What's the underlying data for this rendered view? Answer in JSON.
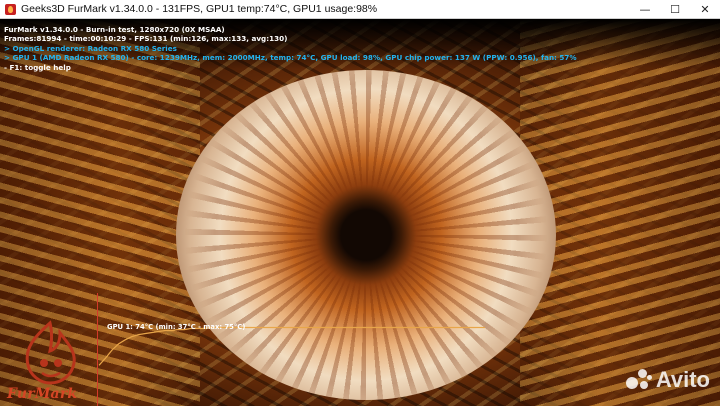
{
  "window": {
    "title": "Geeks3D FurMark v1.34.0.0 - 131FPS, GPU1 temp:74°C, GPU1 usage:98%",
    "icon": "furmark-app-icon",
    "controls": {
      "minimize": "—",
      "maximize": "☐",
      "close": "✕"
    }
  },
  "hud": {
    "line1": "FurMark v1.34.0.0 - Burn-in test, 1280x720 (0X MSAA)",
    "line2": "Frames:81994 - time:00:10:29 - FPS:131 (min:126, max:133, avg:130)",
    "line3": "> OpenGL renderer: Radeon RX 580 Series",
    "line4": "> GPU 1 (AMD Radeon RX 580) - core: 1239MHz, mem: 2000MHz, temp: 74°C, GPU load: 98%, GPU chip power: 137 W (PPW: 0.956), fan: 57%",
    "line5": "- F1: toggle help",
    "colors": {
      "white": "#ffffff",
      "cyan": "#23b3ee"
    }
  },
  "graph": {
    "label": "GPU 1: 74°C (min: 37°C - max: 75°C)",
    "axis_color": "#d33a2a",
    "line_color": "#e8a64a",
    "temps_c": [
      37,
      44,
      52,
      58,
      62,
      65,
      67,
      68,
      69,
      70,
      71,
      71,
      72,
      72,
      73,
      73,
      73,
      74,
      74,
      74,
      74,
      74,
      74,
      74,
      74,
      74,
      74,
      74,
      74,
      74,
      74,
      74,
      74,
      74,
      74,
      74,
      74,
      74,
      74,
      74,
      74,
      74,
      74,
      74,
      74,
      74,
      74,
      74,
      74,
      74,
      74,
      74,
      74,
      74,
      74,
      74,
      74,
      74,
      74,
      74
    ],
    "temp_range_c": [
      0,
      100
    ]
  },
  "logo": {
    "text": "FurMark",
    "color": "#d64525"
  },
  "watermark": {
    "text": "Avito"
  }
}
